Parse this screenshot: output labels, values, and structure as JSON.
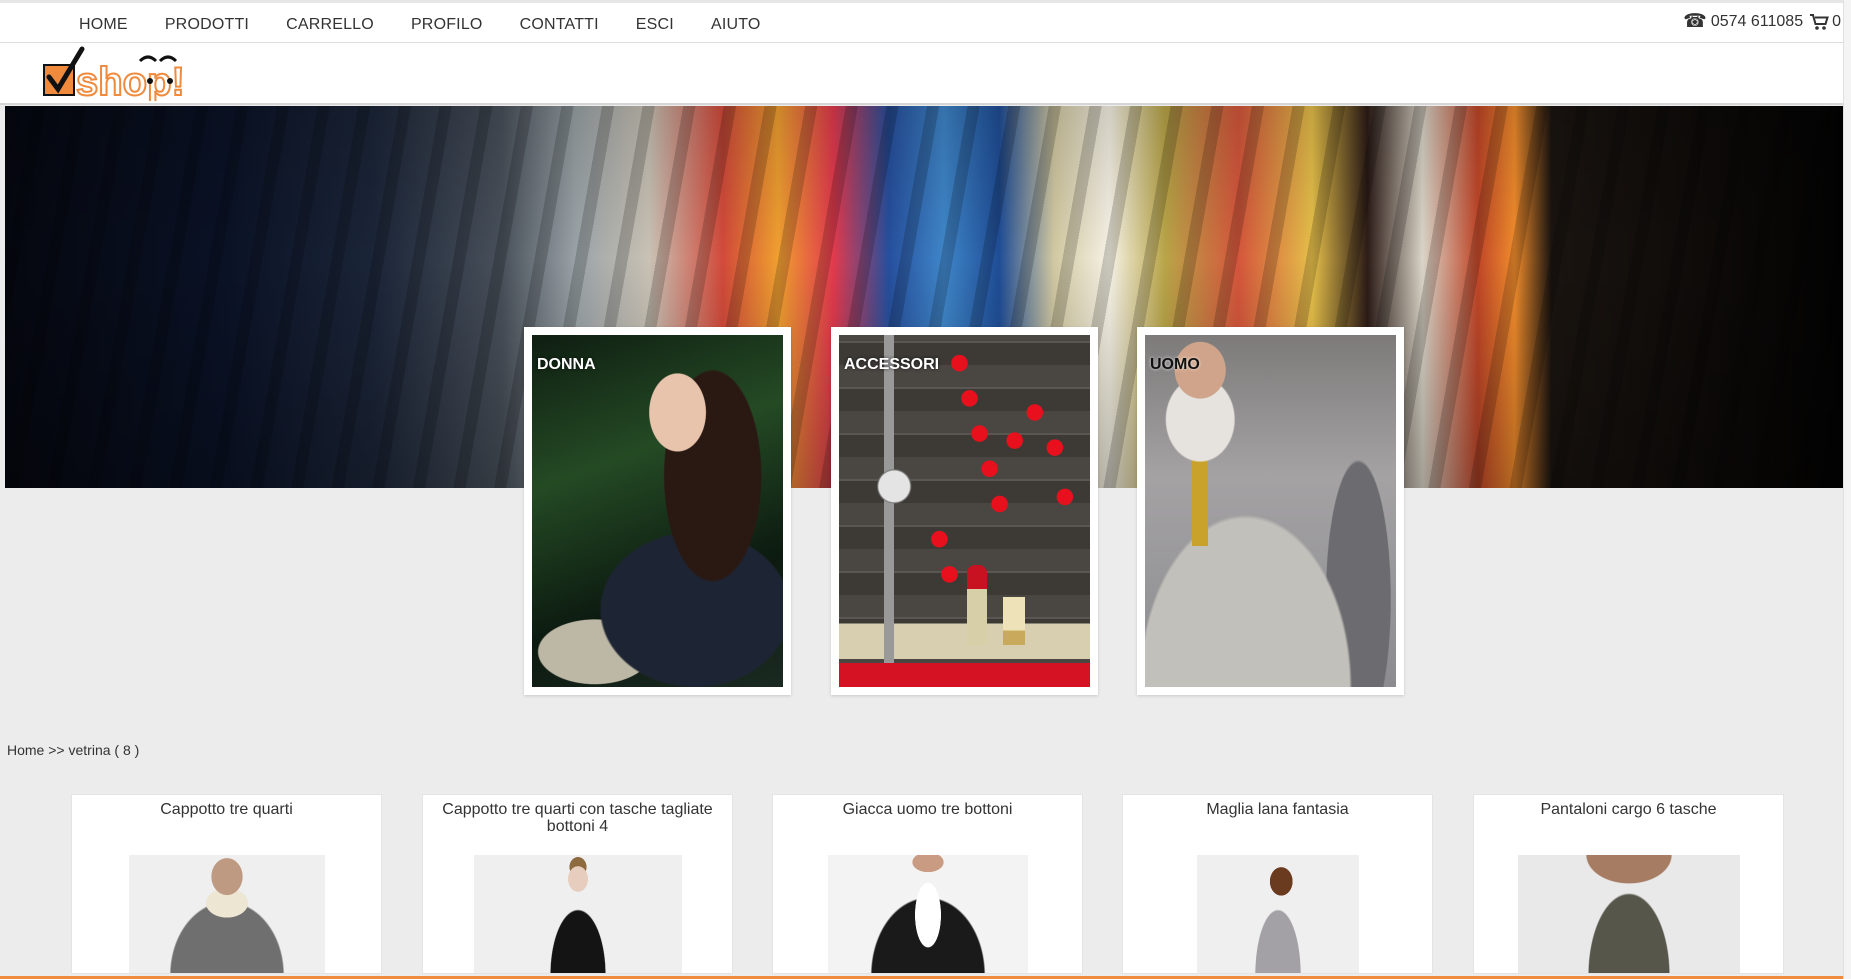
{
  "nav": {
    "items": [
      "HOME",
      "PRODOTTI",
      "CARRELLO",
      "PROFILO",
      "CONTATTI",
      "ESCI",
      "AIUTO"
    ],
    "phone": "0574 611085",
    "cart_count": "0"
  },
  "logo": {
    "text": "shop!"
  },
  "categories": [
    {
      "label": "DONNA"
    },
    {
      "label": "ACCESSORI"
    },
    {
      "label": "UOMO"
    }
  ],
  "breadcrumb": {
    "home": "Home",
    "separator": ">>",
    "current": "vetrina ( 8 )"
  },
  "products": [
    {
      "title": "Cappotto tre quarti"
    },
    {
      "title": "Cappotto tre quarti con tasche tagliate bottoni 4"
    },
    {
      "title": "Giacca uomo tre bottoni"
    },
    {
      "title": "Maglia lana fantasia"
    },
    {
      "title": "Pantaloni cargo 6 tasche"
    }
  ],
  "colors": {
    "accent": "#f08a3c",
    "background": "#ececec"
  }
}
